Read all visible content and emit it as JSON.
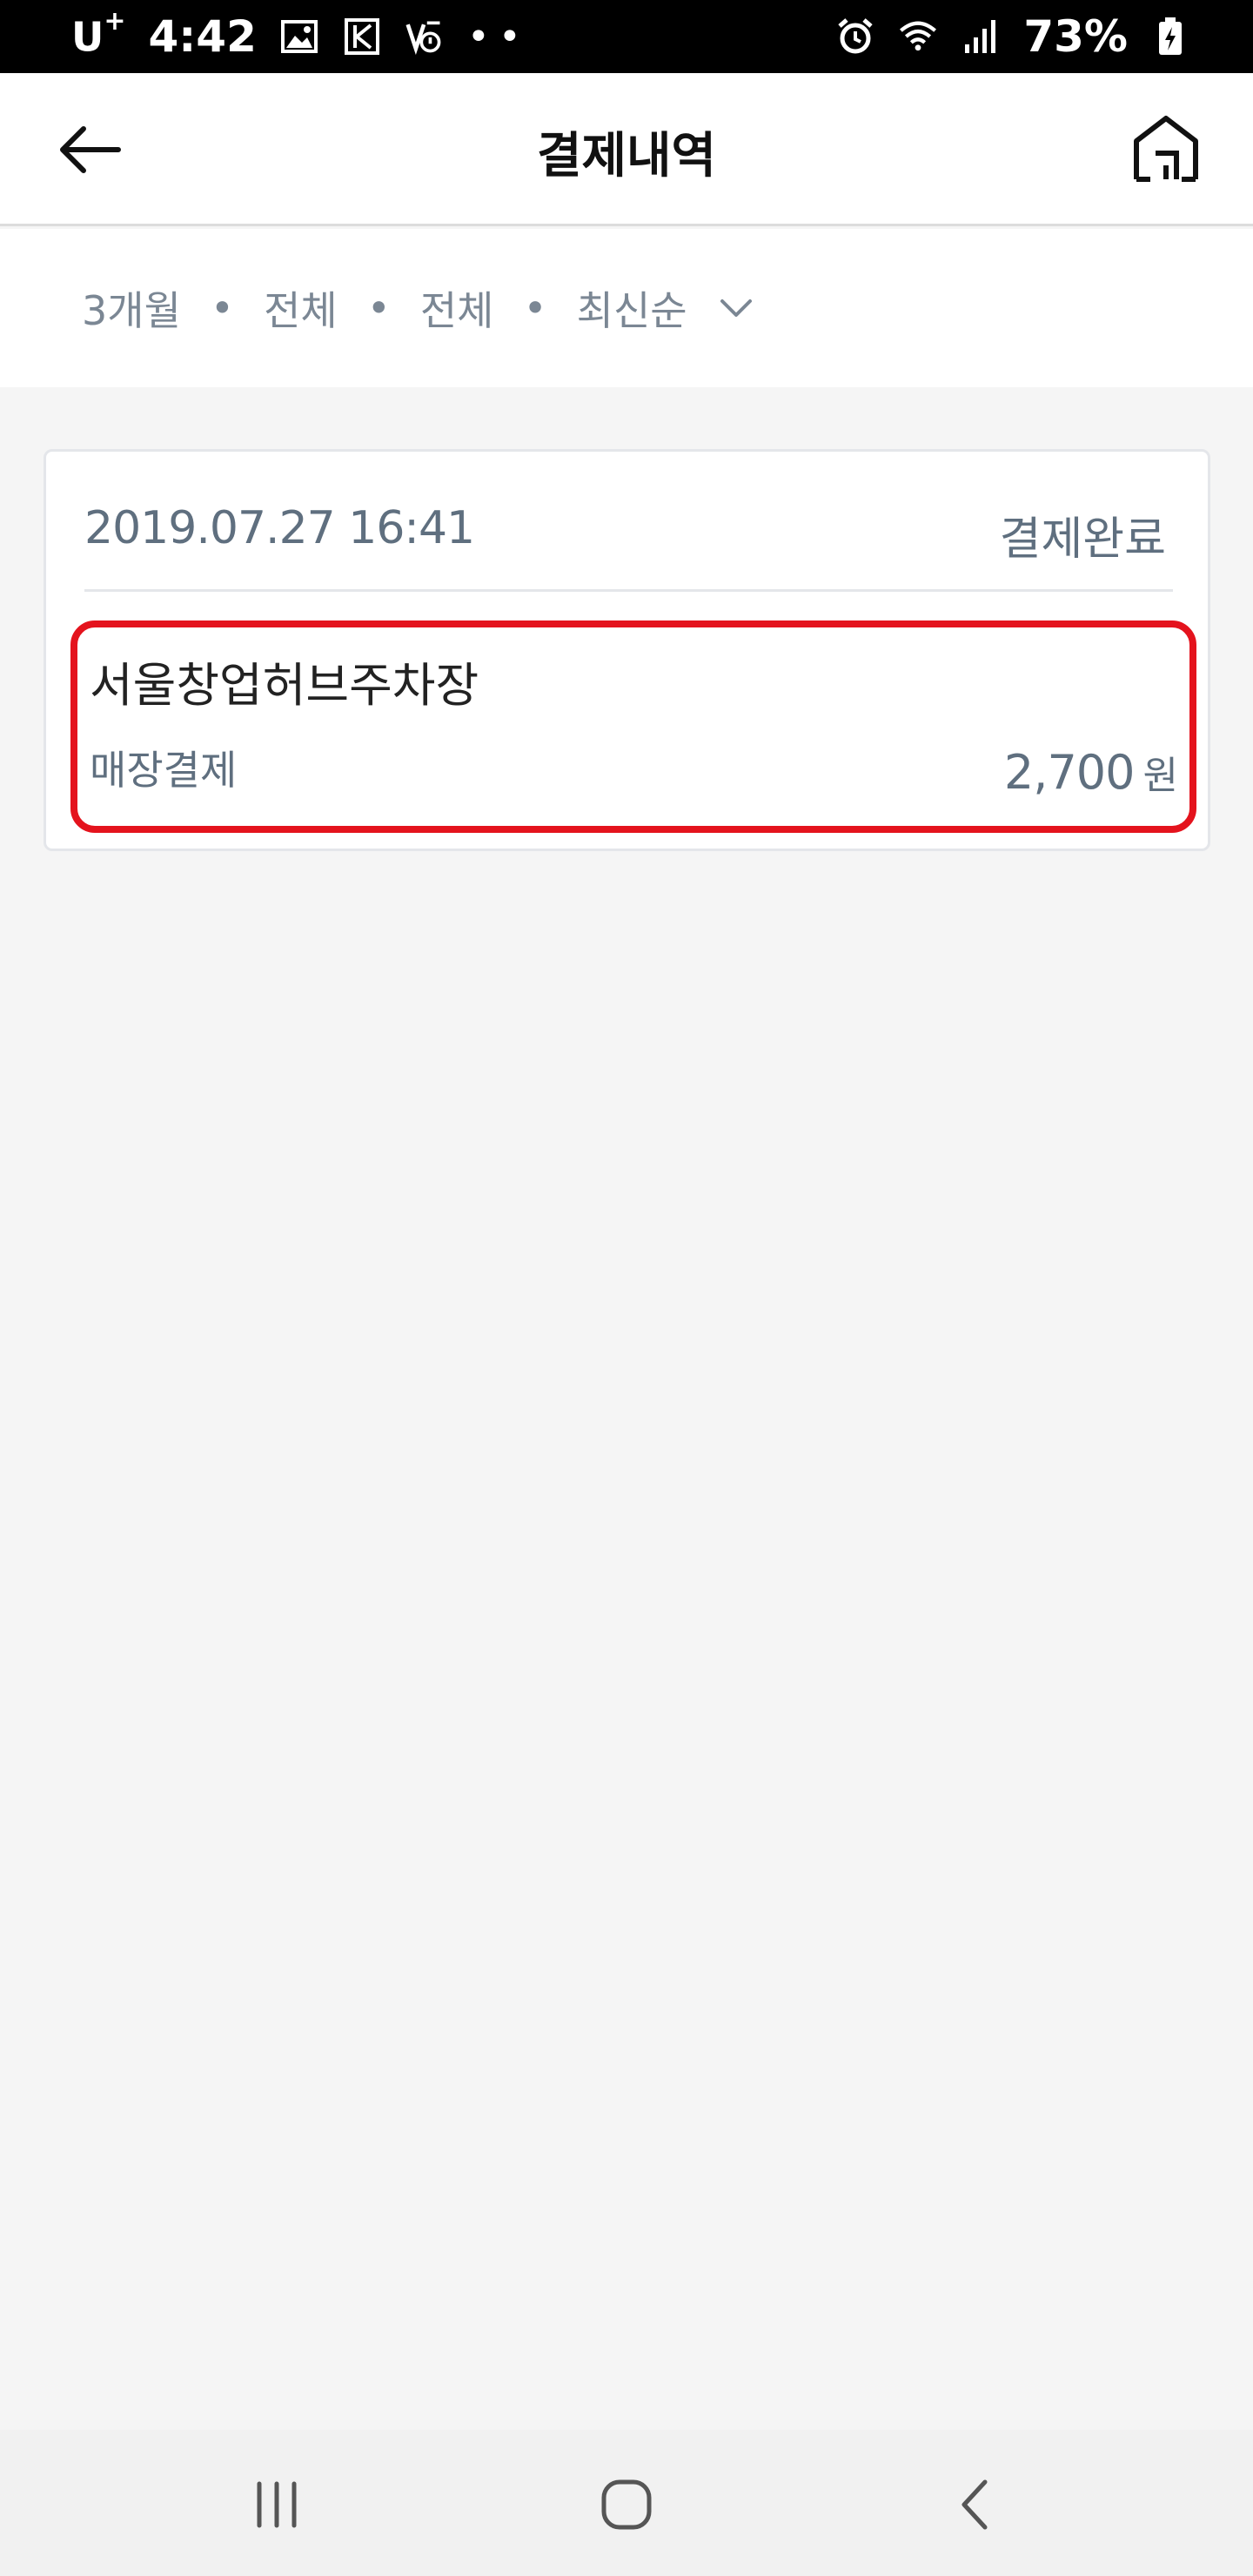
{
  "status_bar": {
    "carrier": "U",
    "carrier_sup": "+",
    "time": "4:42",
    "dots": "••",
    "battery": "73%",
    "icons": [
      "image-icon",
      "k-icon",
      "notification-icon",
      "alarm-icon",
      "wifi-icon",
      "signal-icon",
      "battery-charging-icon"
    ]
  },
  "app_bar": {
    "title": "결제내역",
    "back_icon": "arrow-left-icon",
    "home_icon": "home-icon"
  },
  "filters": {
    "items": [
      "3개월",
      "전체",
      "전체",
      "최신순"
    ],
    "separator": "•",
    "dropdown_icon": "chevron-down-icon"
  },
  "transactions": [
    {
      "datetime": "2019.07.27 16:41",
      "status": "결제완료",
      "store": "서울창업허브주차장",
      "pay_type": "매장결제",
      "amount": "2,700",
      "currency": "원"
    }
  ],
  "colors": {
    "highlight_border": "#e4131d",
    "muted_text": "#5f6f7f",
    "filter_text": "#7b8794",
    "background": "#f5f5f5"
  },
  "nav_bar": {
    "icons": [
      "recent-apps-icon",
      "home-circle-icon",
      "back-chevron-icon"
    ]
  }
}
